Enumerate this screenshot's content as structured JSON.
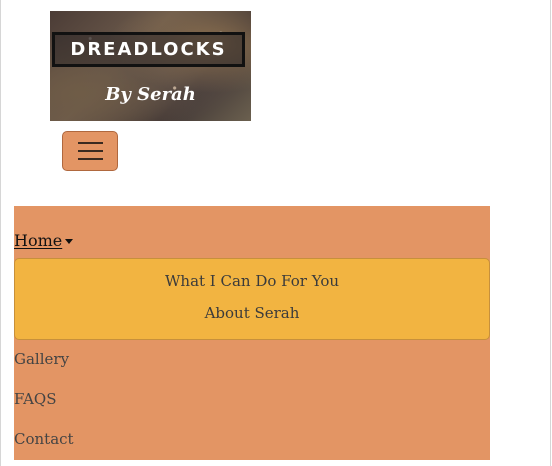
{
  "logo": {
    "title": "DREADLOCKS",
    "subtitle": "By Serah"
  },
  "navbar": {
    "toggler_icon": "hamburger-icon",
    "home_label": "Home",
    "dropdown_icon": "caret-down-icon",
    "dropdown_items": [
      "What I Can Do For You",
      "About Serah"
    ],
    "links": [
      "Gallery",
      "FAQS",
      "Contact"
    ]
  },
  "colors": {
    "nav_background": "#e39564",
    "dropdown_background": "#f2b441",
    "toggler_background": "#e39564"
  }
}
